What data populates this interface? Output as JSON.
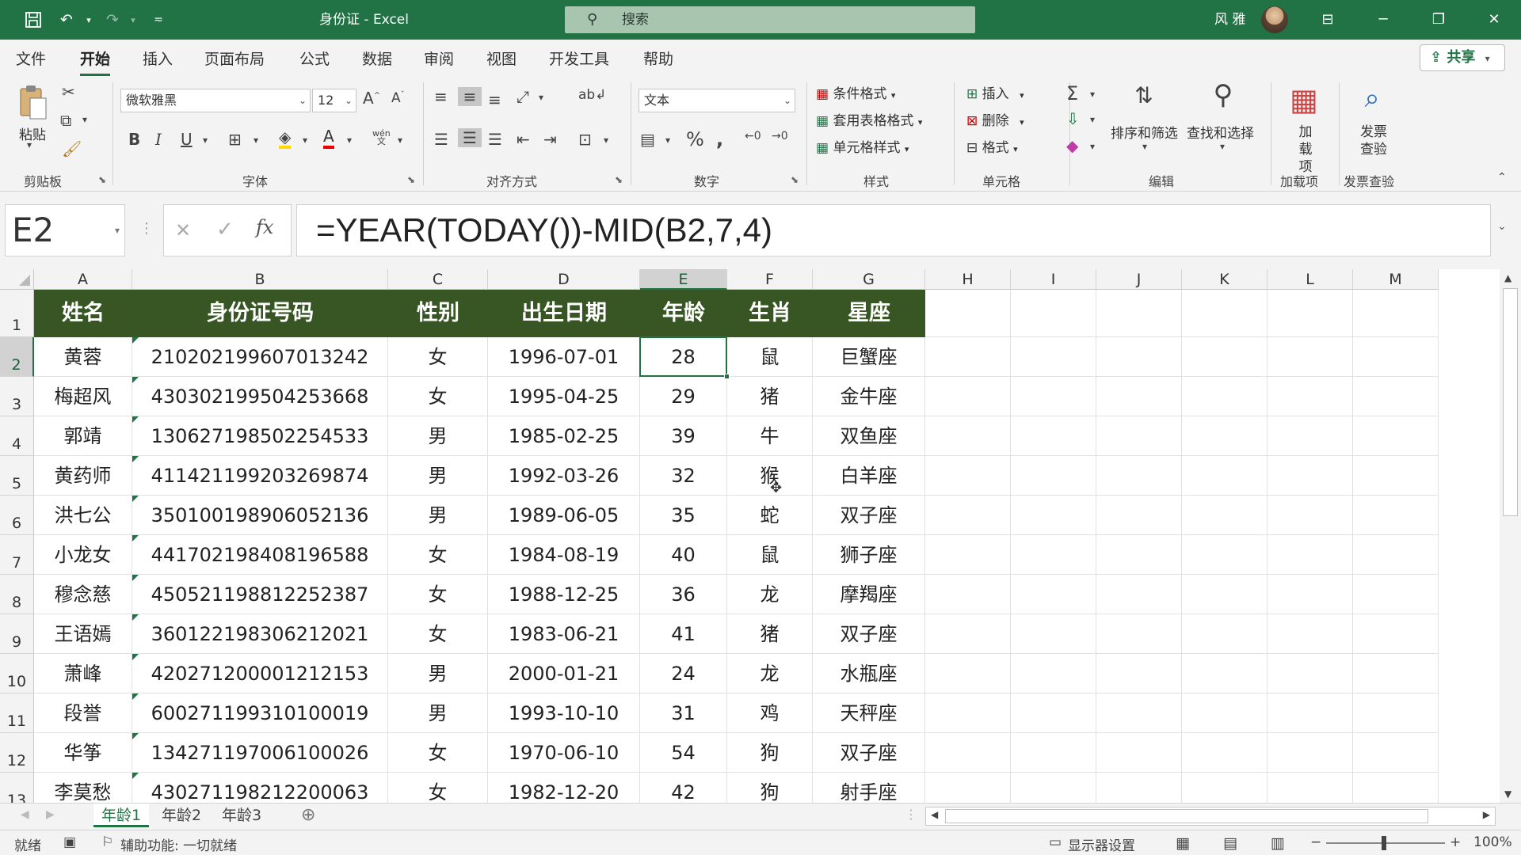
{
  "titlebar": {
    "doc_title": "身份证  -  Excel",
    "search_placeholder": "搜索",
    "user_name": "风 雅",
    "icons": [
      "save-icon",
      "undo-icon",
      "redo-icon",
      "customize-qat-icon",
      "ribbon-display-icon",
      "minimize-icon",
      "restore-icon",
      "close-icon"
    ]
  },
  "menu": {
    "tabs": [
      "文件",
      "开始",
      "插入",
      "页面布局",
      "公式",
      "数据",
      "审阅",
      "视图",
      "开发工具",
      "帮助"
    ],
    "active": "开始",
    "share_label": "共享"
  },
  "ribbon": {
    "clipboard": {
      "paste": "粘贴",
      "label": "剪贴板"
    },
    "font": {
      "name": "微软雅黑",
      "size": "12",
      "label": "字体",
      "bold": "B",
      "italic": "I",
      "underline": "U",
      "phonetic": "wén"
    },
    "alignment": {
      "label": "对齐方式"
    },
    "number": {
      "format": "文本",
      "label": "数字"
    },
    "styles": {
      "conditional": "条件格式",
      "table": "套用表格格式",
      "cell": "单元格样式",
      "label": "样式"
    },
    "cells": {
      "insert": "插入",
      "delete": "删除",
      "format": "格式",
      "label": "单元格"
    },
    "editing": {
      "sort": "排序和筛选",
      "find": "查找和选择",
      "label": "编辑"
    },
    "addins": {
      "button": "加载项",
      "label": "加载项"
    },
    "invoice": {
      "button": "发票查验",
      "label": "发票查验"
    },
    "accent": "#217346"
  },
  "formula_bar": {
    "name_box": "E2",
    "formula": "=YEAR(TODAY())-MID(B2,7,4)"
  },
  "grid": {
    "columns": [
      "A",
      "B",
      "C",
      "D",
      "E",
      "F",
      "G",
      "H",
      "I",
      "J",
      "K",
      "L",
      "M"
    ],
    "selected_col": "E",
    "selected_row": "2",
    "header_row": [
      "姓名",
      "身份证号码",
      "性别",
      "出生日期",
      "年龄",
      "生肖",
      "星座"
    ],
    "rows": [
      {
        "num": "2",
        "cells": [
          "黄蓉",
          "210202199607013242",
          "女",
          "1996-07-01",
          "28",
          "鼠",
          "巨蟹座"
        ]
      },
      {
        "num": "3",
        "cells": [
          "梅超风",
          "430302199504253668",
          "女",
          "1995-04-25",
          "29",
          "猪",
          "金牛座"
        ]
      },
      {
        "num": "4",
        "cells": [
          "郭靖",
          "130627198502254533",
          "男",
          "1985-02-25",
          "39",
          "牛",
          "双鱼座"
        ]
      },
      {
        "num": "5",
        "cells": [
          "黄药师",
          "411421199203269874",
          "男",
          "1992-03-26",
          "32",
          "猴",
          "白羊座"
        ]
      },
      {
        "num": "6",
        "cells": [
          "洪七公",
          "350100198906052136",
          "男",
          "1989-06-05",
          "35",
          "蛇",
          "双子座"
        ]
      },
      {
        "num": "7",
        "cells": [
          "小龙女",
          "441702198408196588",
          "女",
          "1984-08-19",
          "40",
          "鼠",
          "狮子座"
        ]
      },
      {
        "num": "8",
        "cells": [
          "穆念慈",
          "450521198812252387",
          "女",
          "1988-12-25",
          "36",
          "龙",
          "摩羯座"
        ]
      },
      {
        "num": "9",
        "cells": [
          "王语嫣",
          "360122198306212021",
          "女",
          "1983-06-21",
          "41",
          "猪",
          "双子座"
        ]
      },
      {
        "num": "10",
        "cells": [
          "萧峰",
          "420271200001212153",
          "男",
          "2000-01-21",
          "24",
          "龙",
          "水瓶座"
        ]
      },
      {
        "num": "11",
        "cells": [
          "段誉",
          "600271199310100019",
          "男",
          "1993-10-10",
          "31",
          "鸡",
          "天秤座"
        ]
      },
      {
        "num": "12",
        "cells": [
          "华筝",
          "134271197006100026",
          "女",
          "1970-06-10",
          "54",
          "狗",
          "双子座"
        ]
      },
      {
        "num": "13",
        "cells": [
          "李莫愁",
          "430271198212200063",
          "女",
          "1982-12-20",
          "42",
          "狗",
          "射手座"
        ]
      }
    ],
    "header_fill": "#375623"
  },
  "sheets": {
    "tabs": [
      "年龄1",
      "年龄2",
      "年龄3"
    ],
    "active": "年龄1"
  },
  "status": {
    "ready": "就绪",
    "accessibility": "辅助功能: 一切就绪",
    "display_settings": "显示器设置",
    "zoom": "100%"
  }
}
